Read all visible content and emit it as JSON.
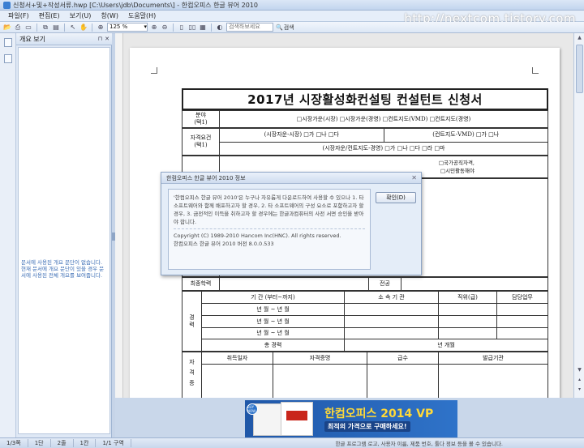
{
  "window": {
    "title": "신청서+및+작성서류.hwp [C:\\Users\\jdb\\Documents\\] - 한컴오피스 한글 뷰어 2010"
  },
  "watermark": "http://nextcom.tistory.com",
  "menu": [
    "파일(F)",
    "편집(E)",
    "보기(U)",
    "창(W)",
    "도움말(H)"
  ],
  "toolbar": {
    "zoom": "125 %",
    "search_placeholder": "검색하보세요",
    "search_label": "검색"
  },
  "sidebar": {
    "header": "개요 보기",
    "message": "문서에 사용된 개요 문단이 없습니다. 현재 문서에 개요 문단이 있을 경우 문서에 사용된 전체 개요를 보여줍니다."
  },
  "form": {
    "title": "2017년 시장활성화컨설팅 컨설턴트 신청서",
    "row1_label": "분야\n(택1)",
    "row1_options": "□시장가운(시장) □시장가운(경영) □컨트지도(VMD) □컨트지도(경영)",
    "row2_label": "자격요건\n(택1)",
    "row2a": "(시장자운-시장)  □가  □나  □다",
    "row2b": "(컨트지도-VMD)  □가  □나",
    "row3": "(시장자운/컨트지도-경영)  □가  □나  □다  □라  □마",
    "row4": "□국가공직자격,",
    "row5": "□시민활동해야",
    "row_edu_label": "최종학력",
    "row_edu_right": "전공",
    "career_label": "경\n력",
    "career_headers": [
      "기  간 (부터~까지)",
      "소 속 기 관",
      "직위(급)",
      "담당업무"
    ],
    "career_rows": [
      "년   월  ~   년   월",
      "년   월  ~   년   월",
      "년   월  ~   년   월"
    ],
    "career_total_left": "총 경력",
    "career_total_right": "년        개월",
    "cert_label": "자\n격\n증",
    "cert_headers": [
      "취득일자",
      "자격증명",
      "급수",
      "발급기관"
    ]
  },
  "dialog": {
    "title": "한컴오피스 한글 뷰어 2010 정보",
    "body": "'한컴오피스 한글 뷰어 2010'은 누구나 자유롭게 다운로드하여 사용할 수 있으나 1. 타 소프트웨어와 함께 배포하고자 할 경우, 2. 타 소프트웨어의 구성 요소로 포함하고자 할 경우, 3. 금전적인 이득을 취하고자 할 경우에는 한글과컴퓨터의 사전 서면 승인을 받아야 합니다.",
    "copyright": "Copyright (C) 1989-2010 Hancom Inc(HNC). All rights reserved.",
    "version": "한컴오피스 한글 뷰어 2010 버전 8.0.0.533",
    "ok": "확인(D)"
  },
  "banner": {
    "line1": "한컴오피스 2014 VP",
    "line2": "최적의 가격으로 구매하세요!",
    "badge": "BUY NOW"
  },
  "status": {
    "page": "1/3쪽",
    "section": "1단",
    "line": "2줄",
    "col": "1칸",
    "pos": "1/1 구역",
    "message": "한글 프로그램 로고, 사용자 이름, 제품 번호, 툴다 정보 등을 볼 수 있습니다."
  }
}
